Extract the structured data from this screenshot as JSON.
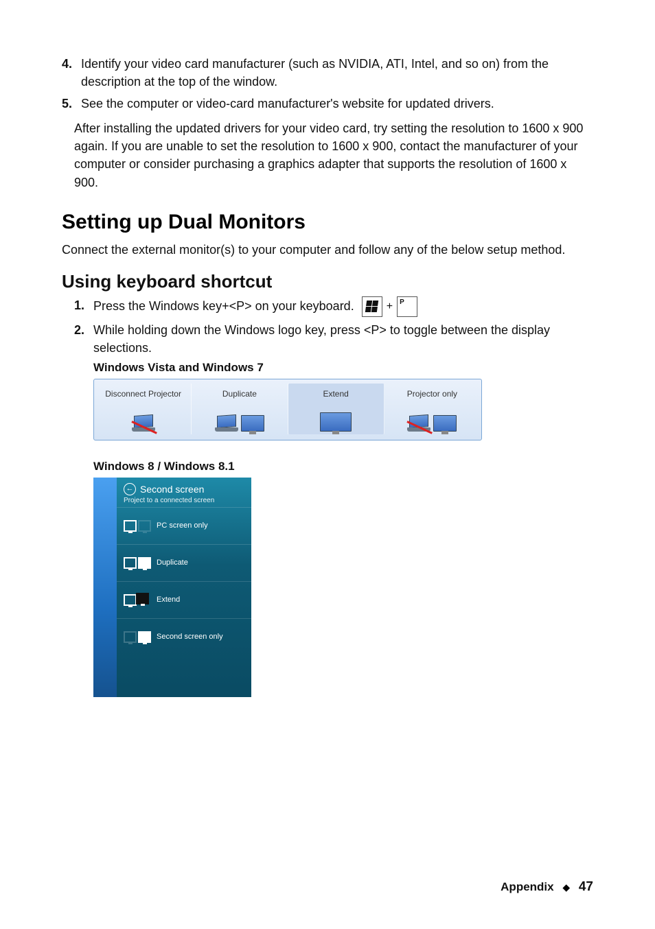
{
  "steps_top": [
    {
      "num": "4.",
      "text": "Identify your video card manufacturer (such as NVIDIA, ATI, Intel, and so on) from the description at the top of the window."
    },
    {
      "num": "5.",
      "text": "See the computer or video-card manufacturer's website for updated drivers."
    }
  ],
  "paragraph_after": "After installing the updated drivers for your video card, try setting the resolution to 1600 x 900 again. If you are unable to set the resolution to 1600 x 900, contact the manufacturer of your computer or consider purchasing a graphics adapter that supports the resolution of 1600 x 900.",
  "section1": "Setting up Dual Monitors",
  "section1_para": "Connect the external monitor(s) to your computer and follow any of the below setup method.",
  "section2": "Using keyboard shortcut",
  "kb_steps": [
    {
      "num": "1.",
      "text": "Press the Windows key+<P> on your keyboard."
    },
    {
      "num": "2.",
      "text": "While holding down the Windows logo key, press <P> to toggle between the display selections."
    }
  ],
  "key_p": "P",
  "plus": "+",
  "vista_heading": "Windows Vista and Windows 7",
  "vista_options": {
    "opt1": "Disconnect Projector",
    "opt2": "Duplicate",
    "opt3": "Extend",
    "opt4": "Projector only"
  },
  "win8_heading": "Windows 8 / Windows 8.1",
  "win8": {
    "title": "Second screen",
    "subtitle": "Project to a connected screen",
    "opt1": "PC screen only",
    "opt2": "Duplicate",
    "opt3": "Extend",
    "opt4": "Second screen only"
  },
  "footer": {
    "label": "Appendix",
    "page": "47"
  }
}
